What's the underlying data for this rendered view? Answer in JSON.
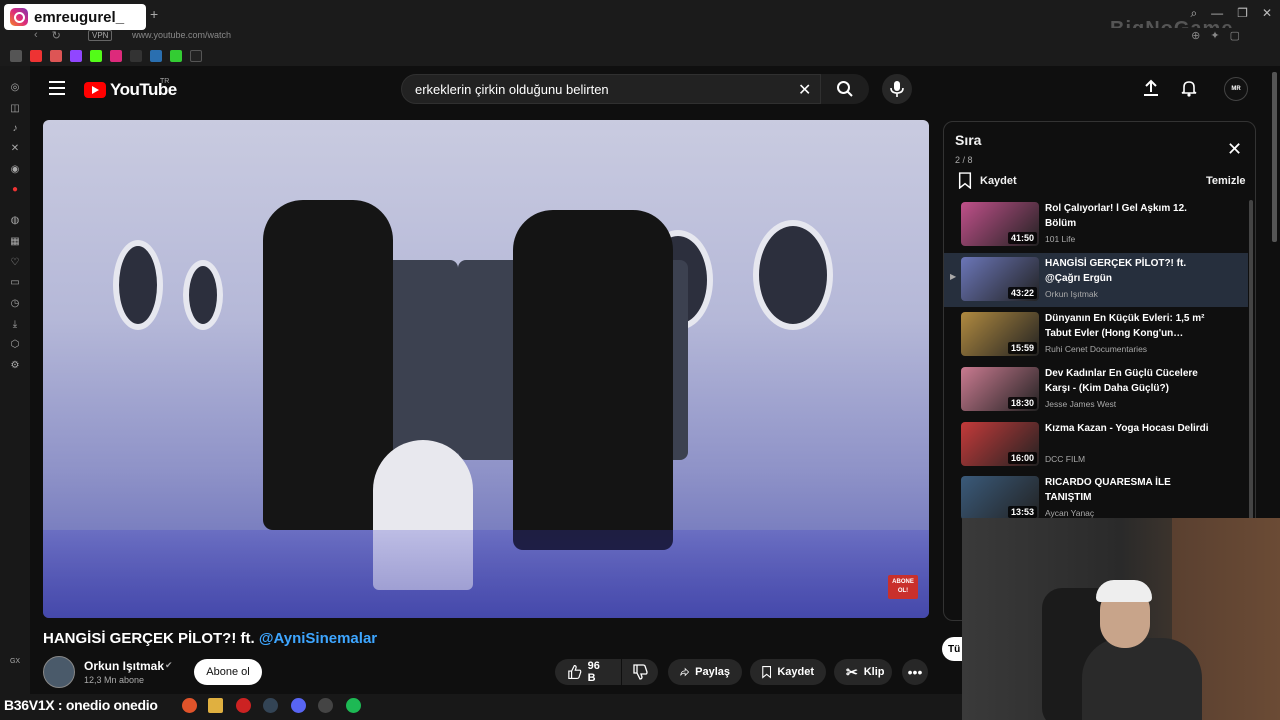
{
  "browser": {
    "profile_badge": "emreugurel_",
    "vpn_label": "VPN",
    "url": "www.youtube.com/watch",
    "watermark": "BigNoGame"
  },
  "sidebar_left": {
    "gx_label": "GX"
  },
  "header": {
    "logo_text": "YouTube",
    "region": "TR",
    "search_value": "erkeklerin çirkin olduğunu belirten",
    "avatar_text": "MR"
  },
  "video": {
    "title_prefix": "HANGİSİ GERÇEK PİLOT?! ft. ",
    "title_mention": "@AyniSinemalar",
    "channel_name": "Orkun Işıtmak",
    "subscribers": "12,3 Mn abone",
    "subscribe_label": "Abone ol",
    "likes": "96 B",
    "share_label": "Paylaş",
    "save_label": "Kaydet",
    "clip_label": "Klip",
    "more_label": "•••",
    "overlay_badge": "ABONE OL!"
  },
  "queue": {
    "title": "Sıra",
    "position": "2 / 8",
    "save_label": "Kaydet",
    "clear_label": "Temizle",
    "items": [
      {
        "title": "Rol Çalıyorlar! l Gel Aşkım 12. Bölüm",
        "channel": "101 Life",
        "duration": "41:50",
        "color": "#c0508a"
      },
      {
        "title": "HANGİSİ GERÇEK PİLOT?! ft. @Çağrı Ergün",
        "channel": "Orkun Işıtmak",
        "duration": "43:22",
        "color": "#6b76b8"
      },
      {
        "title": "Dünyanın En Küçük Evleri: 1,5 m² Tabut Evler (Hong Kong'un…",
        "channel": "Ruhi Cenet Documentaries",
        "duration": "15:59",
        "color": "#b08a40"
      },
      {
        "title": "Dev Kadınlar En Güçlü Cücelere Karşı - (Kim Daha Güçlü?)",
        "channel": "Jesse James West",
        "duration": "18:30",
        "color": "#c97a90"
      },
      {
        "title": "Kızma Kazan - Yoga Hocası Delirdi",
        "channel": "DCC FILM",
        "duration": "16:00",
        "color": "#c43a3a"
      },
      {
        "title": "RICARDO QUARESMA İLE TANIŞTIM",
        "channel": "Aycan Yanaç",
        "duration": "13:53",
        "color": "#3a5a7a"
      }
    ]
  },
  "side_button": "Tü",
  "taskbar": {
    "label": "B36V1X : onedio onedio"
  }
}
